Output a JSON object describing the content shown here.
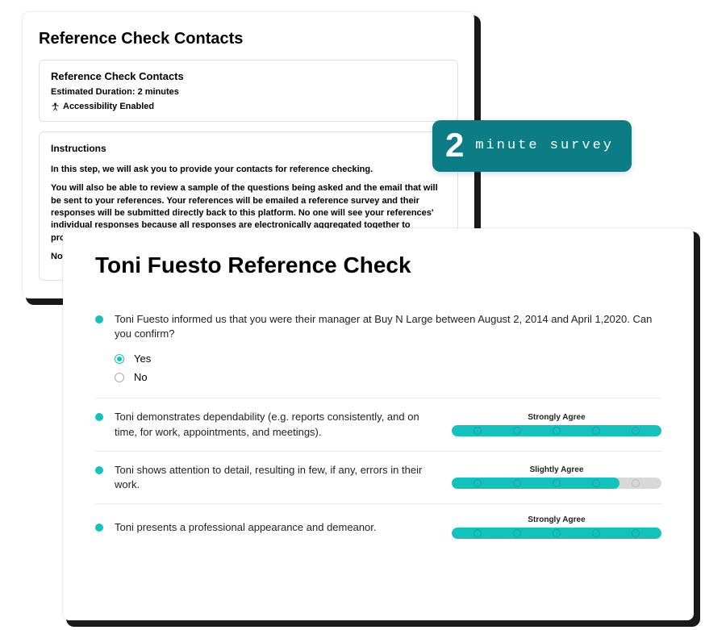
{
  "backCard": {
    "title": "Reference Check Contacts",
    "info": {
      "title": "Reference Check Contacts",
      "durationLabel": "Estimated Duration: 2 minutes",
      "accessibility": "Accessibility Enabled"
    },
    "instructions": {
      "heading": "Instructions",
      "line1": "In this step, we will ask you to provide your contacts for reference checking.",
      "line2": "You will also be able to review a sample of the questions being asked and the email that will be sent to your references. Your references will be emailed a reference survey and their responses will be submitted directly back to this platform. No one will see your references' individual responses because all responses are electronically aggregated together to produce one summary report.",
      "note": "Note"
    }
  },
  "badge": {
    "number": "2",
    "text": "minute survey"
  },
  "frontCard": {
    "title": "Toni Fuesto Reference Check",
    "q1": {
      "text": "Toni Fuesto informed us that you were their manager at Buy N Large between August 2, 2014 and April 1,2020. Can you confirm?",
      "yes": "Yes",
      "no": "No",
      "selected": "yes"
    },
    "q2": {
      "text": "Toni demonstrates dependability (e.g. reports consistently, and on time, for work, appointments, and meetings).",
      "scaleLabel": "Strongly Agree",
      "scalePercent": 100
    },
    "q3": {
      "text": "Toni shows attention to detail, resulting in few, if any, errors in their work.",
      "scaleLabel": "Slightly Agree",
      "scalePercent": 80
    },
    "q4": {
      "text": "Toni presents a professional appearance and demeanor.",
      "scaleLabel": "Strongly Agree",
      "scalePercent": 100
    }
  }
}
